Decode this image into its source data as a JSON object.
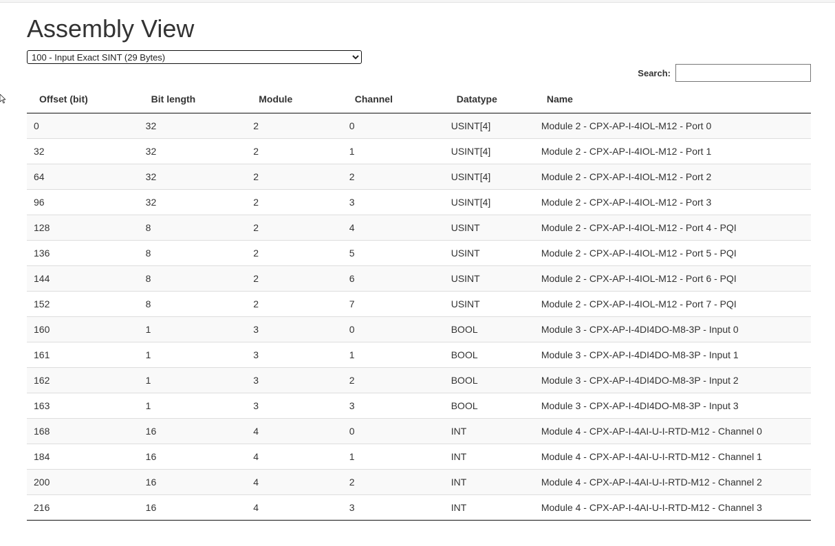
{
  "page": {
    "title": "Assembly View"
  },
  "assembly_select": {
    "selected": "100 - Input Exact SINT (29 Bytes)"
  },
  "search": {
    "label": "Search:",
    "value": ""
  },
  "table": {
    "columns": [
      "Offset (bit)",
      "Bit length",
      "Module",
      "Channel",
      "Datatype",
      "Name"
    ],
    "rows": [
      [
        "0",
        "32",
        "2",
        "0",
        "USINT[4]",
        "Module 2 - CPX-AP-I-4IOL-M12 - Port 0"
      ],
      [
        "32",
        "32",
        "2",
        "1",
        "USINT[4]",
        "Module 2 - CPX-AP-I-4IOL-M12 - Port 1"
      ],
      [
        "64",
        "32",
        "2",
        "2",
        "USINT[4]",
        "Module 2 - CPX-AP-I-4IOL-M12 - Port 2"
      ],
      [
        "96",
        "32",
        "2",
        "3",
        "USINT[4]",
        "Module 2 - CPX-AP-I-4IOL-M12 - Port 3"
      ],
      [
        "128",
        "8",
        "2",
        "4",
        "USINT",
        "Module 2 - CPX-AP-I-4IOL-M12 - Port 4 - PQI"
      ],
      [
        "136",
        "8",
        "2",
        "5",
        "USINT",
        "Module 2 - CPX-AP-I-4IOL-M12 - Port 5 - PQI"
      ],
      [
        "144",
        "8",
        "2",
        "6",
        "USINT",
        "Module 2 - CPX-AP-I-4IOL-M12 - Port 6 - PQI"
      ],
      [
        "152",
        "8",
        "2",
        "7",
        "USINT",
        "Module 2 - CPX-AP-I-4IOL-M12 - Port 7 - PQI"
      ],
      [
        "160",
        "1",
        "3",
        "0",
        "BOOL",
        "Module 3 - CPX-AP-I-4DI4DO-M8-3P - Input 0"
      ],
      [
        "161",
        "1",
        "3",
        "1",
        "BOOL",
        "Module 3 - CPX-AP-I-4DI4DO-M8-3P - Input 1"
      ],
      [
        "162",
        "1",
        "3",
        "2",
        "BOOL",
        "Module 3 - CPX-AP-I-4DI4DO-M8-3P - Input 2"
      ],
      [
        "163",
        "1",
        "3",
        "3",
        "BOOL",
        "Module 3 - CPX-AP-I-4DI4DO-M8-3P - Input 3"
      ],
      [
        "168",
        "16",
        "4",
        "0",
        "INT",
        "Module 4 - CPX-AP-I-4AI-U-I-RTD-M12 - Channel 0"
      ],
      [
        "184",
        "16",
        "4",
        "1",
        "INT",
        "Module 4 - CPX-AP-I-4AI-U-I-RTD-M12 - Channel 1"
      ],
      [
        "200",
        "16",
        "4",
        "2",
        "INT",
        "Module 4 - CPX-AP-I-4AI-U-I-RTD-M12 - Channel 2"
      ],
      [
        "216",
        "16",
        "4",
        "3",
        "INT",
        "Module 4 - CPX-AP-I-4AI-U-I-RTD-M12 - Channel 3"
      ]
    ]
  }
}
